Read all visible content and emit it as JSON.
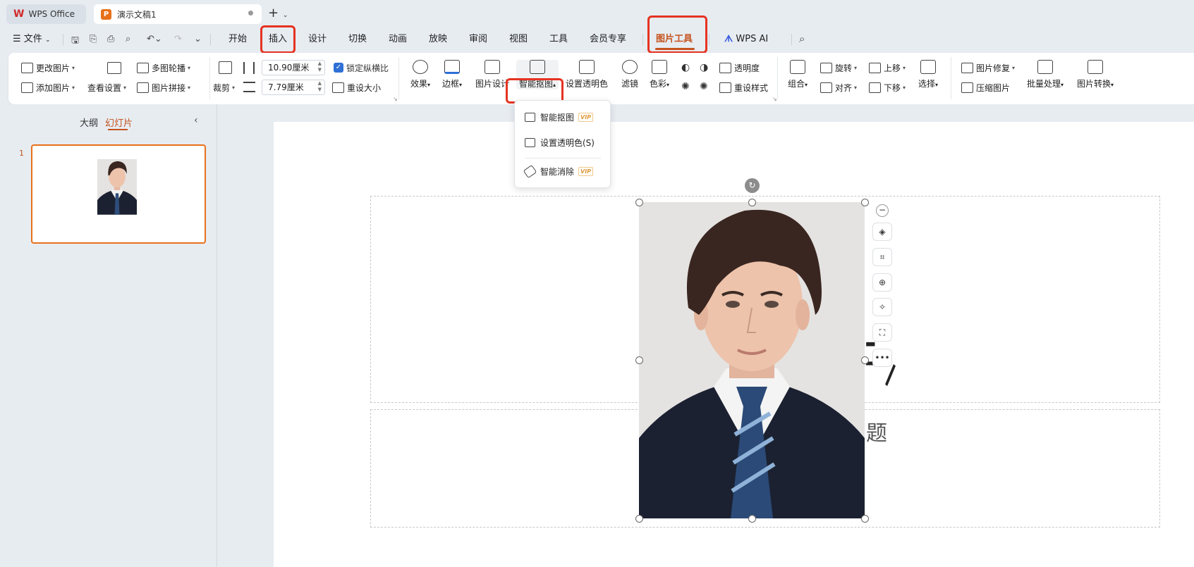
{
  "tabs": {
    "wps_office": "WPS Office",
    "document": "演示文稿1"
  },
  "menu": {
    "file": "文件",
    "items": [
      "开始",
      "插入",
      "设计",
      "切换",
      "动画",
      "放映",
      "审阅",
      "视图",
      "工具",
      "会员专享",
      "图片工具"
    ],
    "wps_ai": "WPS AI",
    "active": "图片工具"
  },
  "ribbon": {
    "change_picture": "更改图片",
    "add_picture": "添加图片",
    "view_settings": "查看设置",
    "multi_carousel": "多图轮播",
    "picture_collage": "图片拼接",
    "crop": "裁剪",
    "width_value": "10.90厘米",
    "height_value": "7.79厘米",
    "lock_ratio": "锁定纵横比",
    "reset_size": "重设大小",
    "effects": "效果",
    "border": "边框",
    "picture_design": "图片设计",
    "smart_cutout": "智能抠图",
    "set_transparent": "设置透明色",
    "filter": "滤镜",
    "color": "色彩",
    "transparency": "透明度",
    "reset_style": "重设样式",
    "group": "组合",
    "rotate": "旋转",
    "align": "对齐",
    "move_up": "上移",
    "move_down": "下移",
    "select": "选择",
    "picture_repair": "图片修复",
    "compress_picture": "压缩图片",
    "batch_process": "批量处理",
    "picture_convert": "图片转换"
  },
  "dropdown": {
    "items": [
      {
        "label": "智能抠图",
        "badge": "VIP"
      },
      {
        "label": "设置透明色(S)",
        "badge": ""
      },
      {
        "label": "智能消除",
        "badge": "VIP"
      }
    ]
  },
  "sidebar": {
    "outline_tab": "大纲",
    "slides_tab": "幻灯片",
    "slide_number": "1"
  },
  "slide": {
    "subtitle_partial": "题"
  },
  "colors": {
    "accent": "#c6531f",
    "highlight": "#e53322",
    "selection": "#e8701a"
  }
}
